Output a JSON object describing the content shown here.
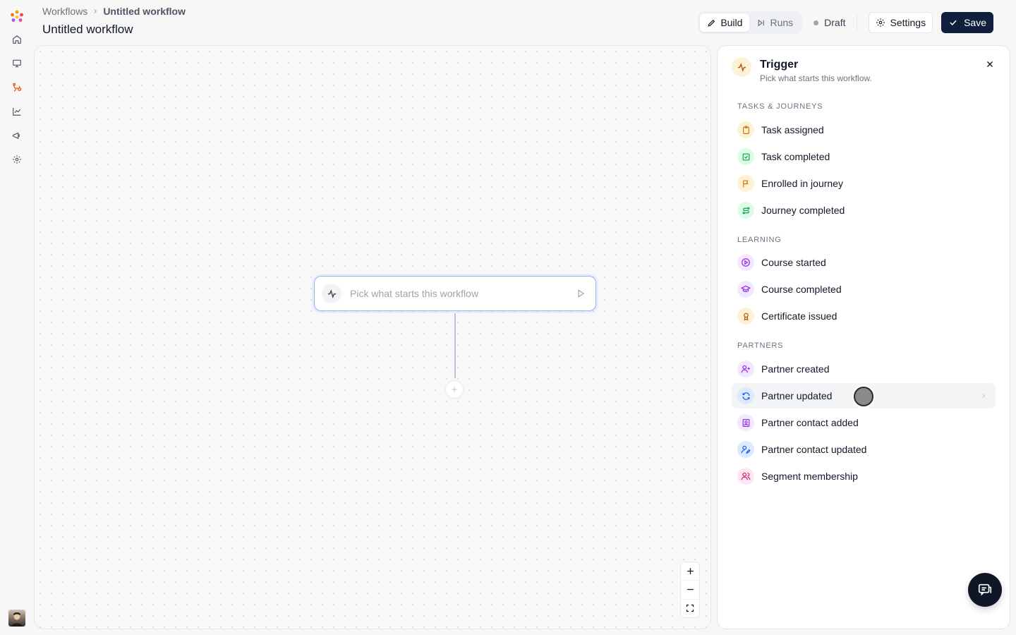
{
  "breadcrumb": {
    "root": "Workflows",
    "current": "Untitled workflow"
  },
  "page": {
    "title": "Untitled workflow"
  },
  "tabs": [
    {
      "label": "Build",
      "active": true
    },
    {
      "label": "Runs",
      "active": false
    }
  ],
  "status": {
    "label": "Draft"
  },
  "actions": {
    "settings_label": "Settings",
    "save_label": "Save"
  },
  "canvas": {
    "node_placeholder": "Pick what starts this workflow"
  },
  "panel": {
    "title": "Trigger",
    "subtitle": "Pick what starts this workflow.",
    "sections": [
      {
        "label": "TASKS & JOURNEYS",
        "items": [
          {
            "label": "Task assigned",
            "icon": "clipboard-icon",
            "color": "#d97706",
            "bg": "#fdf1d6"
          },
          {
            "label": "Task completed",
            "icon": "check-square-icon",
            "color": "#16a34a",
            "bg": "#dcfce7"
          },
          {
            "label": "Enrolled in journey",
            "icon": "flag-icon",
            "color": "#d97706",
            "bg": "#fdf1d6"
          },
          {
            "label": "Journey completed",
            "icon": "route-icon",
            "color": "#16a34a",
            "bg": "#dcfce7"
          }
        ]
      },
      {
        "label": "LEARNING",
        "items": [
          {
            "label": "Course started",
            "icon": "play-circle-icon",
            "color": "#9333ea",
            "bg": "#f3e8ff"
          },
          {
            "label": "Course completed",
            "icon": "graduation-cap-icon",
            "color": "#9333ea",
            "bg": "#f3e8ff"
          },
          {
            "label": "Certificate issued",
            "icon": "award-icon",
            "color": "#b45309",
            "bg": "#fdf1d6"
          }
        ]
      },
      {
        "label": "PARTNERS",
        "items": [
          {
            "label": "Partner created",
            "icon": "user-plus-icon",
            "color": "#9333ea",
            "bg": "#f3e8ff"
          },
          {
            "label": "Partner updated",
            "icon": "refresh-icon",
            "color": "#2563eb",
            "bg": "#dbeafe"
          },
          {
            "label": "Partner contact added",
            "icon": "contact-icon",
            "color": "#9333ea",
            "bg": "#f3e8ff"
          },
          {
            "label": "Partner contact updated",
            "icon": "user-pen-icon",
            "color": "#2563eb",
            "bg": "#dbeafe"
          },
          {
            "label": "Segment membership",
            "icon": "users-icon",
            "color": "#db2777",
            "bg": "#fce7f3"
          }
        ]
      }
    ]
  }
}
